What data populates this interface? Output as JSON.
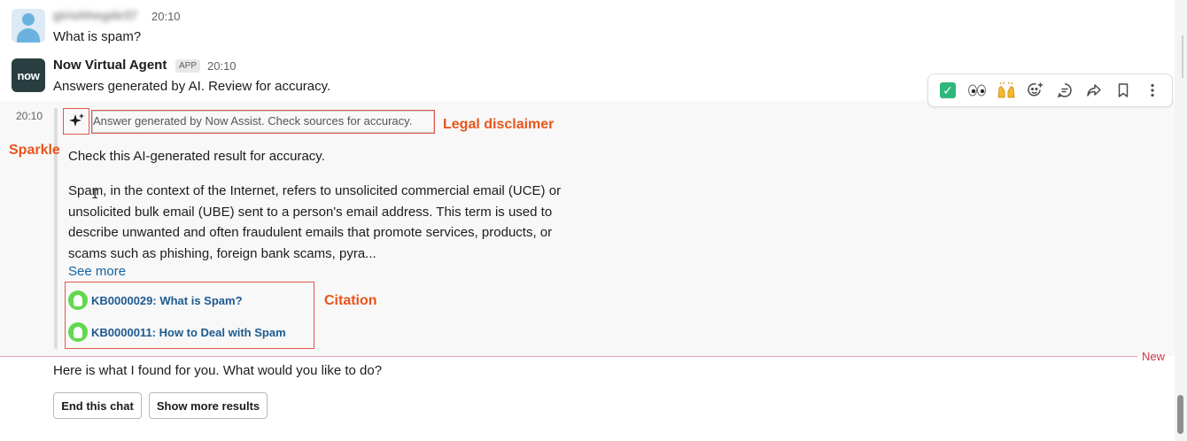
{
  "messages": {
    "user": {
      "name": "girishhegde37",
      "time": "20:10",
      "text": "What is spam?"
    },
    "bot": {
      "avatar_text": "now",
      "name": "Now Virtual Agent",
      "badge": "APP",
      "time": "20:10",
      "text": "Answers generated by AI. Review for accuracy."
    },
    "answer_block": {
      "time": "20:10",
      "disclaimer": "Answer generated by Now Assist. Check sources for accuracy.",
      "check_text": "Check this AI-generated result for accuracy.",
      "answer_lines": [
        "Spam, in the context of the Internet, refers to unsolicited commercial email (UCE) or",
        "unsolicited bulk email (UBE) sent to a person's email address. This term is used to",
        "describe unwanted and often fraudulent emails that promote services, products, or",
        "scams such as phishing, foreign bank scams, pyra..."
      ],
      "see_more": "See more",
      "citations": [
        {
          "label": "KB0000029: What is Spam?"
        },
        {
          "label": "KB0000011: How to Deal with Spam"
        }
      ]
    },
    "followup": {
      "text": "Here is what I found for you. What would you like to do?",
      "buttons": {
        "end_chat": "End this chat",
        "show_more": "Show more results"
      }
    }
  },
  "annotations": {
    "legal": "Legal disclaimer",
    "sparkle": "Sparkle",
    "citation": "Citation"
  },
  "divider": {
    "new_label": "New"
  },
  "toolbar": {
    "icons": [
      "check-mark-emoji",
      "eyes-emoji",
      "raised-hands-emoji",
      "add-reaction-icon",
      "reply-thread-icon",
      "share-icon",
      "bookmark-icon",
      "more-actions-icon"
    ]
  },
  "colors": {
    "annotation": "#e8541c",
    "link": "#1264a3",
    "citation_icon": "#62d84e",
    "new_divider": "#c9354a",
    "bot_avatar": "#293e40"
  }
}
